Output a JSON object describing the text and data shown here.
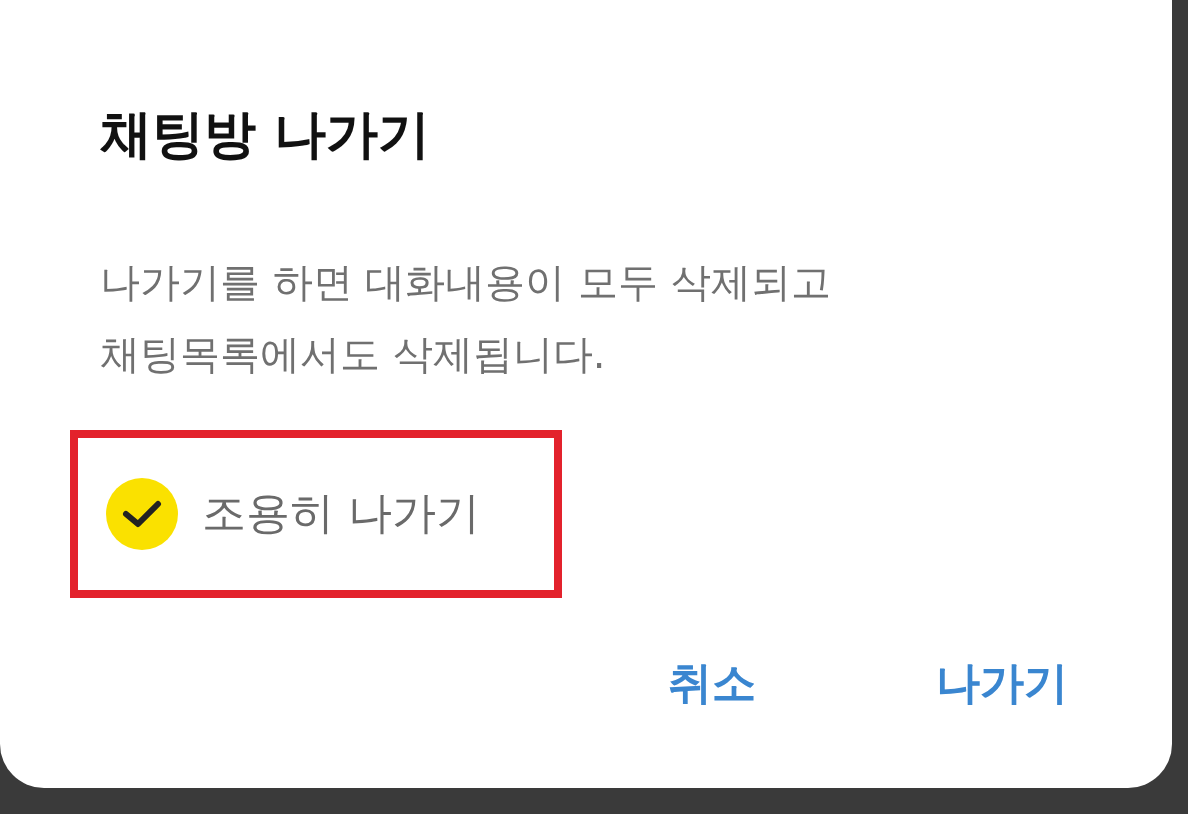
{
  "dialog": {
    "title": "채팅방 나가기",
    "message": "나가기를 하면 대화내용이 모두 삭제되고\n채팅목록에서도 삭제됩니다.",
    "option": {
      "label": "조용히 나가기",
      "checked": true,
      "highlighted": true
    },
    "buttons": [
      {
        "label": "취소"
      },
      {
        "label": "나가기"
      }
    ]
  }
}
